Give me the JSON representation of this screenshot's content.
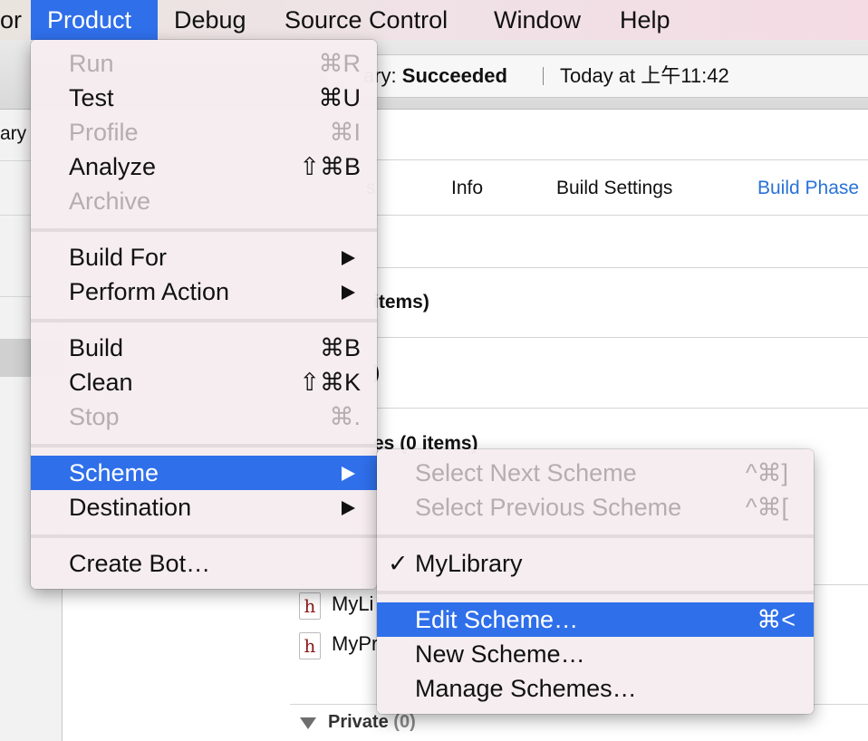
{
  "menubar": {
    "items": [
      {
        "label": "or"
      },
      {
        "label": "Product"
      },
      {
        "label": "Debug"
      },
      {
        "label": "Source Control"
      },
      {
        "label": "Window"
      },
      {
        "label": "Help"
      }
    ]
  },
  "activity": {
    "status_prefix": "ary: ",
    "status_value": "Succeeded",
    "timestamp": "Today at 上午11:42"
  },
  "navigator": {
    "partial_label": "ary"
  },
  "editor": {
    "tabs": [
      {
        "label": "s"
      },
      {
        "label": "Info"
      },
      {
        "label": "Build Settings"
      },
      {
        "label": "Build Phase"
      }
    ],
    "sections": [
      {
        "label": "items)"
      },
      {
        "label": ")"
      },
      {
        "label": "es (0 items)"
      }
    ],
    "files": [
      {
        "icon": "h",
        "name": "MyLi"
      },
      {
        "icon": "h",
        "name": "MyPr"
      }
    ],
    "private_label": "Private",
    "private_count": "(0)"
  },
  "product_menu": {
    "items": [
      {
        "label": "Run",
        "shortcut": "⌘R"
      },
      {
        "label": "Test",
        "shortcut": "⌘U"
      },
      {
        "label": "Profile",
        "shortcut": "⌘I"
      },
      {
        "label": "Analyze",
        "shortcut": "⇧⌘B"
      },
      {
        "label": "Archive",
        "shortcut": ""
      },
      {
        "label": "Build For",
        "shortcut": ""
      },
      {
        "label": "Perform Action",
        "shortcut": ""
      },
      {
        "label": "Build",
        "shortcut": "⌘B"
      },
      {
        "label": "Clean",
        "shortcut": "⇧⌘K"
      },
      {
        "label": "Stop",
        "shortcut": "⌘."
      },
      {
        "label": "Scheme",
        "shortcut": ""
      },
      {
        "label": "Destination",
        "shortcut": ""
      },
      {
        "label": "Create Bot…",
        "shortcut": ""
      }
    ]
  },
  "scheme_menu": {
    "items": [
      {
        "label": "Select Next Scheme",
        "shortcut": "^⌘]"
      },
      {
        "label": "Select Previous Scheme",
        "shortcut": "^⌘["
      },
      {
        "label": "MyLibrary",
        "shortcut": "",
        "check": "✓"
      },
      {
        "label": "Edit Scheme…",
        "shortcut": "⌘<"
      },
      {
        "label": "New Scheme…",
        "shortcut": ""
      },
      {
        "label": "Manage Schemes…",
        "shortcut": ""
      }
    ]
  },
  "colors": {
    "highlight": "#2f6fea",
    "tab_active": "#2a72d8"
  }
}
